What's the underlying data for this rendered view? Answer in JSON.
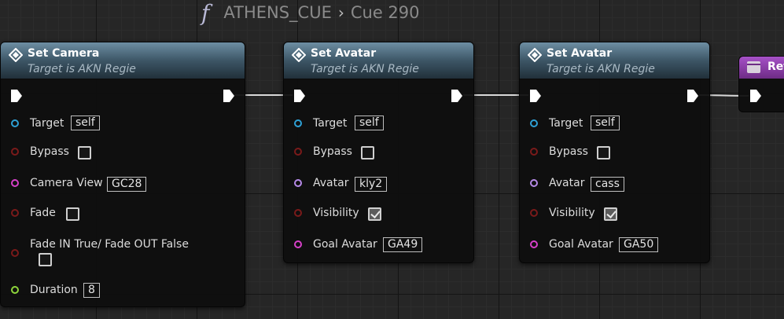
{
  "breadcrumb": {
    "function": "ATHENS_CUE",
    "separator": "›",
    "graph": "Cue 290"
  },
  "colors": {
    "node_header": "#3d5666",
    "return_header": "#8a3fa8",
    "object_pin": "#2ea1d6",
    "bool_pin": "#7a1a1a",
    "struct_pin": "#d640c8",
    "avatar_pin": "#b68ae8",
    "float_pin": "#8ed53b",
    "wire": "#d8d8d8"
  },
  "nodes": [
    {
      "title": "Set Camera",
      "subtitle": "Target is AKN Regie",
      "pins": [
        {
          "label": "Target",
          "value": "self"
        },
        {
          "label": "Bypass",
          "checked": false
        },
        {
          "label": "Camera View",
          "value": "GC28"
        },
        {
          "label": "Fade",
          "checked": false
        },
        {
          "label": "Fade IN True/ Fade OUT False",
          "checked": false
        },
        {
          "label": "Duration",
          "value": "8"
        }
      ]
    },
    {
      "title": "Set Avatar",
      "subtitle": "Target is AKN Regie",
      "pins": [
        {
          "label": "Target",
          "value": "self"
        },
        {
          "label": "Bypass",
          "checked": false
        },
        {
          "label": "Avatar",
          "value": "kly2"
        },
        {
          "label": "Visibility",
          "checked": true
        },
        {
          "label": "Goal Avatar",
          "value": "GA49"
        }
      ]
    },
    {
      "title": "Set Avatar",
      "subtitle": "Target is AKN Regie",
      "pins": [
        {
          "label": "Target",
          "value": "self"
        },
        {
          "label": "Bypass",
          "checked": false
        },
        {
          "label": "Avatar",
          "value": "cass"
        },
        {
          "label": "Visibility",
          "checked": true
        },
        {
          "label": "Goal Avatar",
          "value": "GA50"
        }
      ]
    }
  ],
  "return_node": {
    "title": "Ret"
  }
}
